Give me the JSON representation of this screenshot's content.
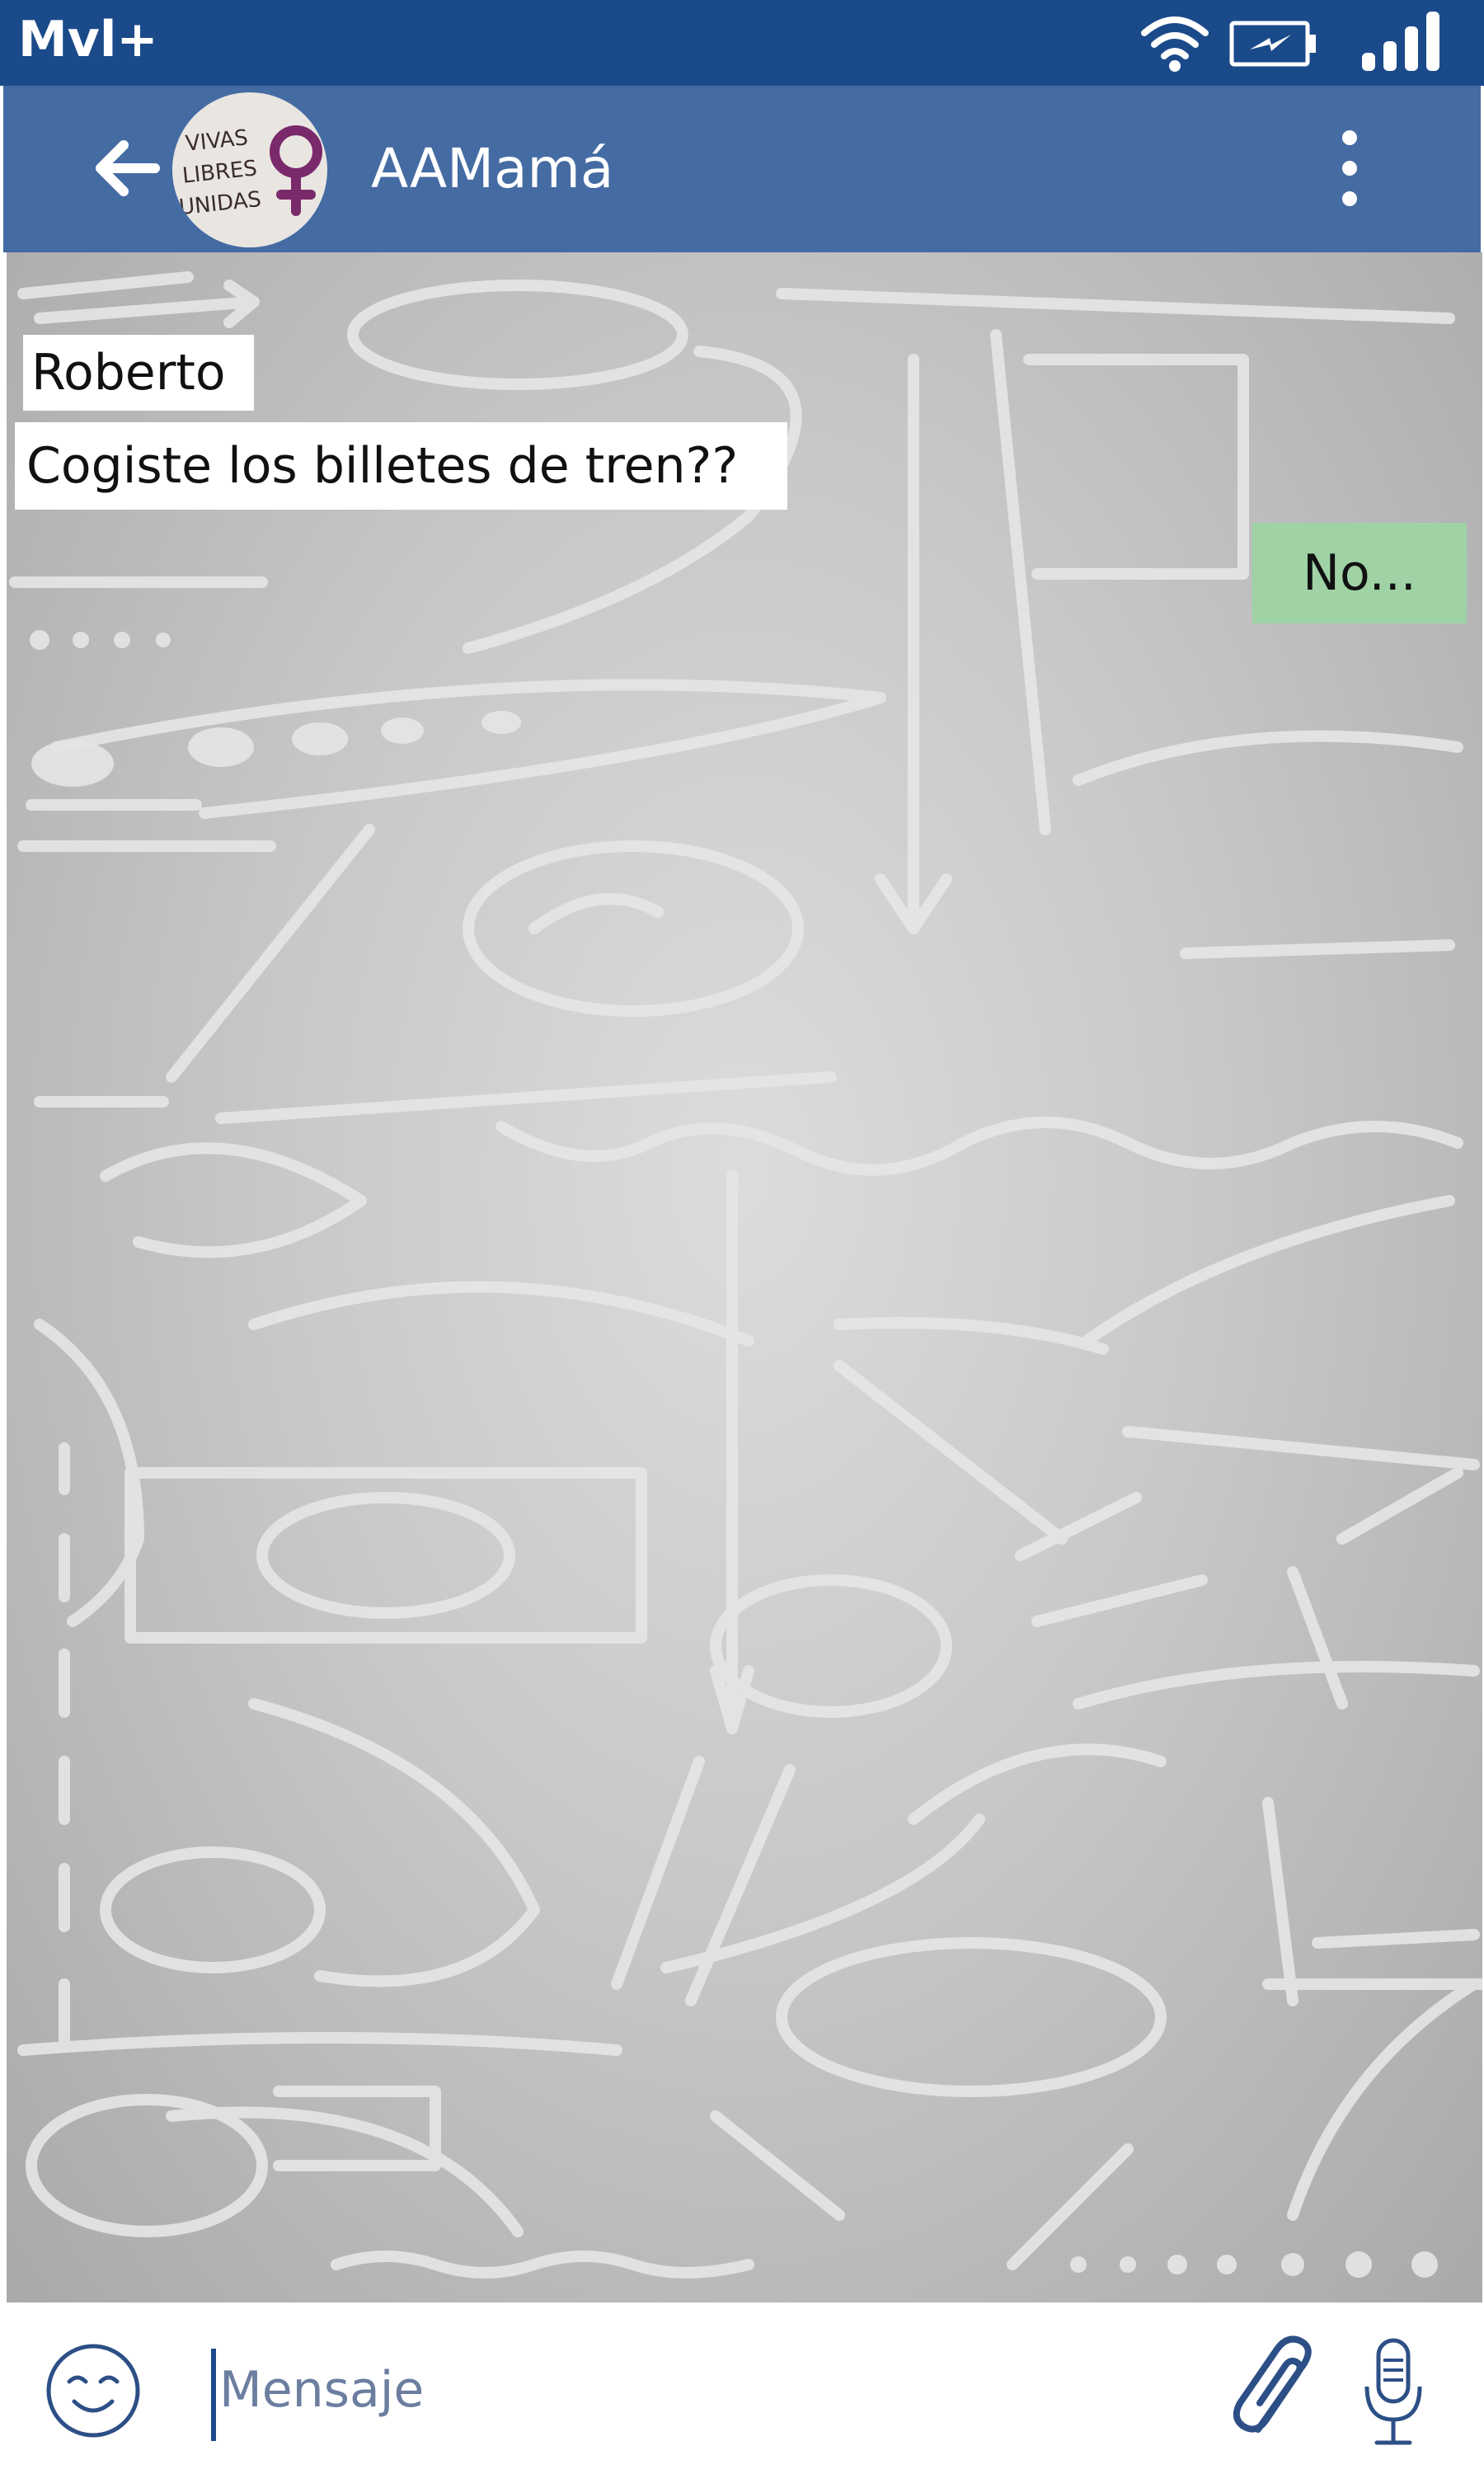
{
  "status_bar": {
    "carrier": "Mvl+",
    "icons": [
      "wifi-icon",
      "battery-charging-icon",
      "signal-icon"
    ]
  },
  "header": {
    "title": "AAMamá",
    "avatar": {
      "lines": [
        "VIVAS",
        "LIBRES",
        "UNIDAS"
      ],
      "symbol": "venus-icon"
    },
    "icons": [
      "back-arrow-icon",
      "more-vert-icon"
    ]
  },
  "messages": [
    {
      "direction": "incoming",
      "sender": "Roberto",
      "text": "Cogiste los billetes de tren??"
    },
    {
      "direction": "outgoing",
      "text": "No..."
    }
  ],
  "composer": {
    "placeholder": "Mensaje",
    "icons": [
      "emoji-icon",
      "attach-icon",
      "mic-icon"
    ]
  },
  "colors": {
    "status_bar": "#1b4a8a",
    "app_bar": "#456ba3",
    "incoming_bubble": "#ffffff",
    "outgoing_bubble": "#9fd3a6",
    "icon_blue": "#2c4f86",
    "avatar_symbol": "#7a2a6a"
  }
}
